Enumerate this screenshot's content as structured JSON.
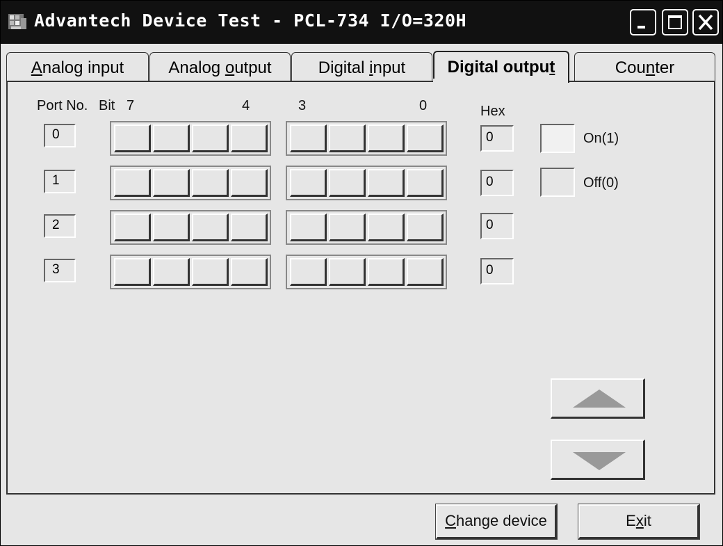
{
  "window": {
    "title": "Advantech Device Test - PCL-734 I/O=320H"
  },
  "tabs": [
    {
      "pre": "",
      "key": "A",
      "post": "nalog input",
      "active": false
    },
    {
      "pre": "Analog ",
      "key": "o",
      "post": "utput",
      "active": false
    },
    {
      "pre": "Digital ",
      "key": "i",
      "post": "nput",
      "active": false
    },
    {
      "pre": "Digital outpu",
      "key": "t",
      "post": "",
      "active": true
    },
    {
      "pre": "Cou",
      "key": "n",
      "post": "ter",
      "active": false
    }
  ],
  "header": {
    "port_no": "Port No.",
    "bit": "Bit",
    "bit7": "7",
    "bit4": "4",
    "bit3": "3",
    "bit0": "0",
    "hex": "Hex"
  },
  "ports": [
    {
      "number": "0",
      "hex": "0"
    },
    {
      "number": "1",
      "hex": "0"
    },
    {
      "number": "2",
      "hex": "0"
    },
    {
      "number": "3",
      "hex": "0"
    }
  ],
  "legend": {
    "on": "On(1)",
    "off": "Off(0)"
  },
  "buttons": {
    "change_device_key": "C",
    "change_device_rest": "hange device",
    "exit_pre": "E",
    "exit_key": "x",
    "exit_post": "it"
  },
  "colors": {
    "titlebar": "#111111",
    "face": "#e6e6e6",
    "on_indicator": "#f1f1f1"
  }
}
